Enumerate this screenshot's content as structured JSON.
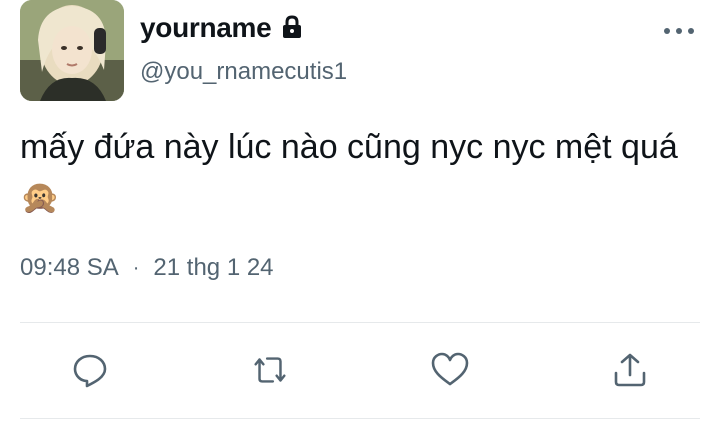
{
  "user": {
    "display_name": "yourname",
    "handle": "@you_rnamecutis1",
    "protected_icon": "lock-icon"
  },
  "tweet": {
    "text": "mấy đứa này lúc nào cũng nyc nyc mệt quá",
    "emoji": "🙊",
    "time": "09:48 SA",
    "separator": "·",
    "date": "21 thg 1 24"
  },
  "actions": [
    "reply-icon",
    "retweet-icon",
    "like-icon",
    "share-icon"
  ],
  "colors": {
    "text": "#0f1419",
    "secondary": "#536471",
    "divider": "#e6e9eb"
  }
}
